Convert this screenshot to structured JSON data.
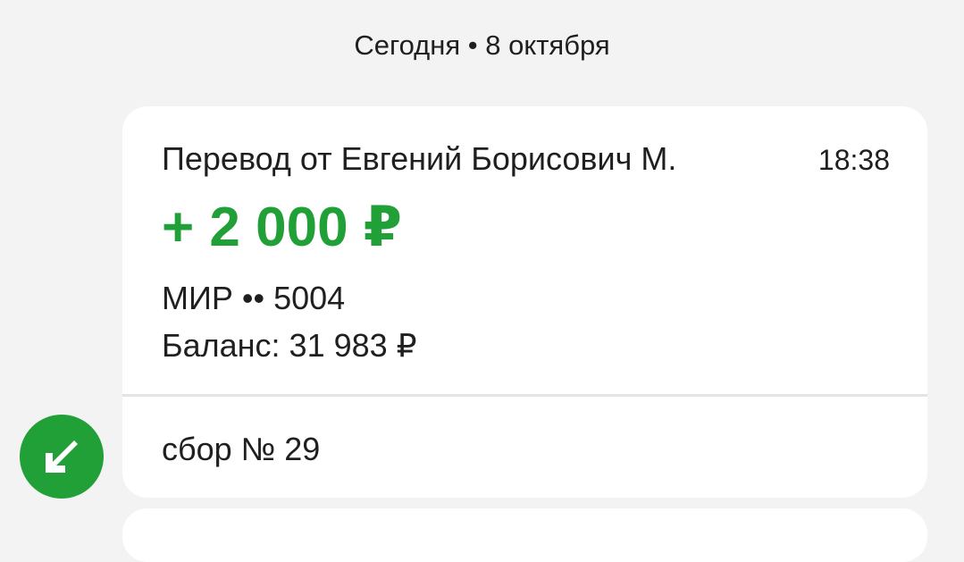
{
  "date_header": "Сегодня • 8 октября",
  "transaction": {
    "title": "Перевод от Евгений Борисович М.",
    "time": "18:38",
    "amount": "+ 2 000 ₽",
    "card": "МИР •• 5004",
    "balance": "Баланс: 31 983 ₽",
    "comment": "сбор № 29"
  },
  "icons": {
    "incoming": "arrow-down-left-icon"
  },
  "colors": {
    "accent_green": "#21a038",
    "background": "#f3f3f3",
    "card": "#ffffff"
  }
}
